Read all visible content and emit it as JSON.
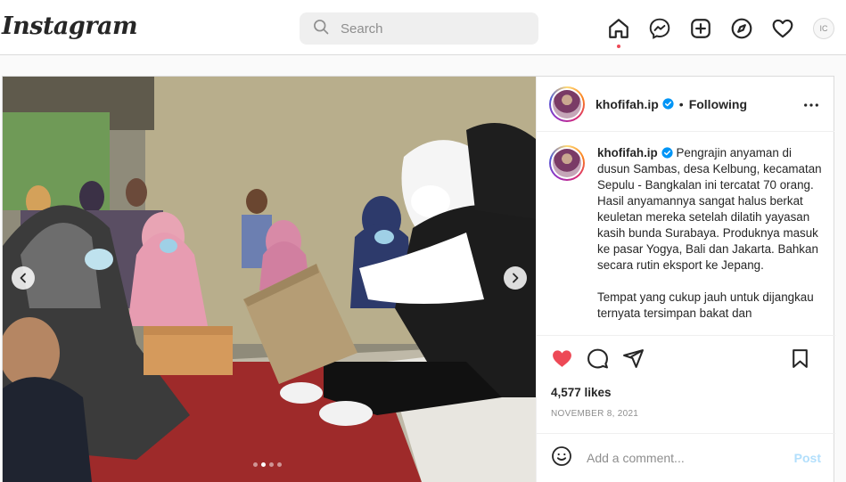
{
  "brand": {
    "logo_text": "Instagram"
  },
  "search": {
    "placeholder": "Search"
  },
  "nav": {
    "icons": [
      "home-icon",
      "messenger-icon",
      "new-post-icon",
      "explore-icon",
      "activity-heart-icon",
      "profile-avatar"
    ],
    "profile_initials": "IC"
  },
  "post": {
    "username": "khofifah.ip",
    "following_label": "Following",
    "bullet": "•",
    "caption": {
      "username": "khofifah.ip",
      "paragraph1": "Pengrajin anyaman di dusun Sambas, desa Kelbung, kecamatan Sepulu - Bangkalan ini tercatat 70 orang. Hasil anyamannya sangat halus berkat keuletan mereka setelah dilatih yayasan kasih bunda Surabaya. Produknya masuk ke pasar Yogya, Bali dan Jakarta. Bahkan secara rutin eksport ke Jepang.",
      "paragraph2": "Tempat yang cukup jauh untuk dijangkau ternyata tersimpan bakat dan"
    },
    "likes": "4,577 likes",
    "date": "NOVEMBER 8, 2021",
    "comment_placeholder": "Add a comment...",
    "post_button": "Post",
    "carousel": {
      "count": 4,
      "active_index": 1
    }
  },
  "colors": {
    "like_red": "#ed4956",
    "verified_blue": "#0095f6",
    "post_button_disabled": "#b2dffc"
  }
}
